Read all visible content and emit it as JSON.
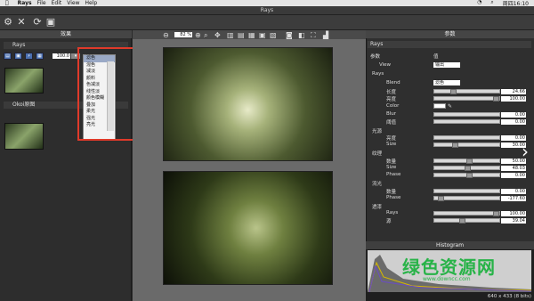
{
  "menubar": {
    "app": "Rays",
    "items": [
      "File",
      "Edit",
      "View",
      "Help"
    ],
    "clock": "周四16:10"
  },
  "window": {
    "title": "Rays"
  },
  "left": {
    "header": "效果",
    "layer1_title": "Rays",
    "opacity_value": "100.0",
    "blend_selected": "滤色",
    "blend_options": [
      "滤色",
      "混色",
      "减淡",
      "颜料",
      "色减淡",
      "线性淡",
      "颜色模糊",
      "叠加",
      "柔光",
      "强光",
      "亮光"
    ],
    "layer2_title": "Okoi原图"
  },
  "center": {
    "zoom": "82 %"
  },
  "right": {
    "header": "参数",
    "subheader": "Rays",
    "col_param": "参数",
    "col_value": "值",
    "view_label": "View",
    "view_value": "输出",
    "rays_group": "Rays",
    "blend_label": "Blend",
    "blend_value": "滤色",
    "length_label": "长度",
    "length_val": "24.66",
    "brightness_label": "亮度",
    "brightness_val": "100.00",
    "color_label": "Color",
    "blur_label": "Blur",
    "blur_val": "0.00",
    "threshold_label": "阈值",
    "threshold_val": "0.00",
    "glow_group": "光源",
    "glow_amt_label": "亮度",
    "glow_amt_val": "0.00",
    "size_label": "Size",
    "size_val": "30.00",
    "texture_group": "纹理",
    "tex_amt_label": "数量",
    "tex_amt_val": "50.00",
    "tex_size_label": "Size",
    "tex_size_val": "48.03",
    "phase_label": "Phase",
    "phase_val": "0.00",
    "flow_group": "流光",
    "flow_amt_label": "数量",
    "flow_amt_val": "0.00",
    "flow_phase_label": "Phase",
    "flow_phase_val": "-177.60",
    "trans_group": "透漆",
    "trans_rays_label": "Rays",
    "trans_rays_val": "100.00",
    "trans_src_label": "源",
    "trans_src_val": "39.04"
  },
  "histogram": {
    "title": "Histogram",
    "status": "640 x 433 (8 bits)"
  },
  "watermark": {
    "text": "绿色资源网",
    "url": "www.downcc.com"
  }
}
